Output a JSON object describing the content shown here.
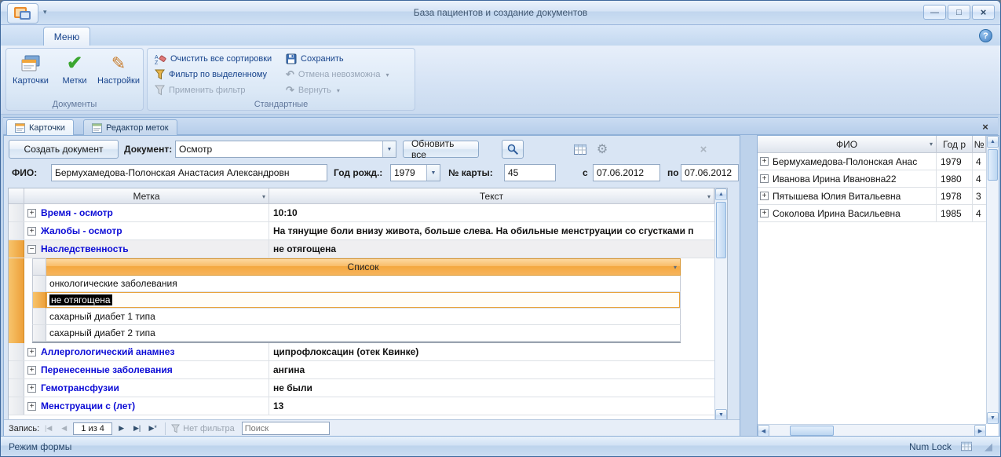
{
  "window": {
    "title": "База пациентов и создание документов"
  },
  "ribbon": {
    "tab": "Меню",
    "documents": {
      "label": "Документы",
      "cards": "Карточки",
      "marks": "Метки",
      "settings": "Настройки"
    },
    "standard": {
      "label": "Стандартные",
      "clear_sorts": "Очистить все сортировки",
      "filter_selection": "Фильтр по выделенному",
      "apply_filter": "Применить фильтр",
      "save": "Сохранить",
      "undo": "Отмена невозможна",
      "redo": "Вернуть"
    }
  },
  "doc_tabs": {
    "cards": "Карточки",
    "label_editor": "Редактор меток"
  },
  "toolbar": {
    "create": "Создать документ",
    "document_label": "Документ:",
    "document_value": "Осмотр",
    "refresh": "Обновить все"
  },
  "filter_bar": {
    "fio_label": "ФИО:",
    "fio_value": "Бермухамедова-Полонская Анастасия Александровн",
    "year_label": "Год рожд.:",
    "year_value": "1979",
    "card_label": "№ карты:",
    "card_value": "45",
    "from_label": "с",
    "from_value": "07.06.2012",
    "to_label": "по",
    "to_value": "07.06.2012"
  },
  "grid": {
    "col_label": "Метка",
    "col_text": "Текст",
    "rows": [
      {
        "label": "Время - осмотр",
        "text": "10:10"
      },
      {
        "label": "Жалобы - осмотр",
        "text": "На тянущие боли внизу живота, больше слева. На обильные менструации со сгустками п"
      },
      {
        "label": "Наследственность",
        "text": "не отягощена"
      },
      {
        "label": "Аллергологический анамнез",
        "text": "ципрофлоксацин (отек Квинке)"
      },
      {
        "label": "Перенесенные заболевания",
        "text": "ангина"
      },
      {
        "label": "Гемотрансфузии",
        "text": "не были"
      },
      {
        "label": "Менструации с (лет)",
        "text": "13"
      }
    ],
    "subsheet": {
      "header": "Список",
      "rows": [
        "онкологические заболевания",
        "не отягощена",
        "сахарный диабет 1 типа",
        "сахарный диабет 2 типа"
      ]
    }
  },
  "patients": {
    "col_fio": "ФИО",
    "col_year": "Год р",
    "col_card": "№",
    "rows": [
      {
        "fio": "Бермухамедова-Полонская Анас",
        "year": "1979",
        "card": "4"
      },
      {
        "fio": "Иванова Ирина Ивановна22",
        "year": "1980",
        "card": "4"
      },
      {
        "fio": "Пятышева Юлия Витальевна",
        "year": "1978",
        "card": "3"
      },
      {
        "fio": "Соколова Ирина Васильевна",
        "year": "1985",
        "card": "4"
      }
    ]
  },
  "recnav": {
    "label": "Запись:",
    "count": "1 из 4",
    "no_filter": "Нет фильтра",
    "search_placeholder": "Поиск"
  },
  "status": {
    "mode": "Режим формы",
    "numlock": "Num Lock"
  },
  "icons": {
    "qat": "▾",
    "minimize": "—",
    "maximize": "□",
    "close": "×",
    "help": "?",
    "check": "✔",
    "pencil": "✎",
    "undo": "↶",
    "redo": "↷",
    "dropdown": "▾",
    "combo": "▼",
    "sort": "▾",
    "gear": "⚙",
    "clear": "×",
    "expand": "+",
    "collapse": "−",
    "tab_close": "×",
    "nav_first": "|◀",
    "nav_prev": "◀",
    "nav_next": "▶",
    "nav_last": "▶|",
    "nav_new": "▶*",
    "up": "▲",
    "down": "▼",
    "left": "◀",
    "right": "▶",
    "grip": "◢"
  }
}
